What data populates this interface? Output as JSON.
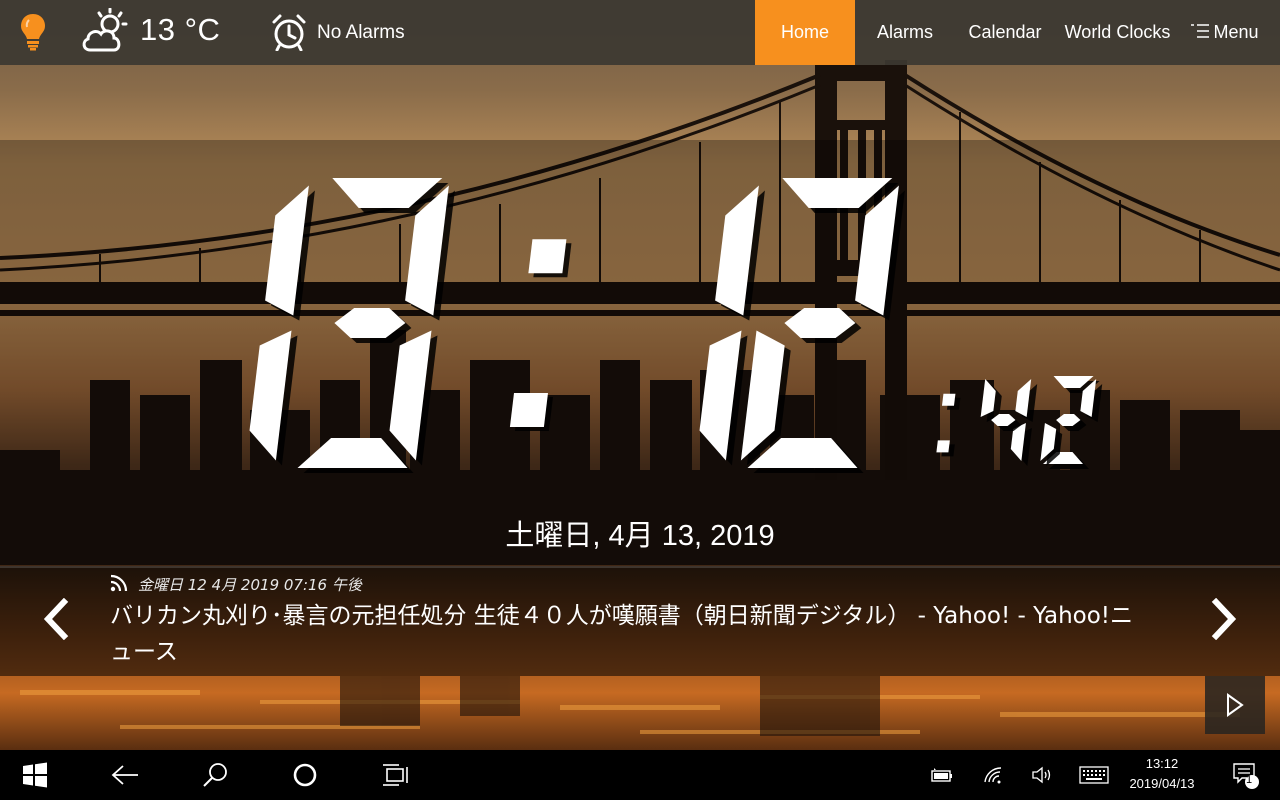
{
  "header": {
    "weather_icon": "partly-cloudy-icon",
    "temperature": "13 °C",
    "alarm_icon": "alarm-clock-icon",
    "alarm_status": "No Alarms",
    "accent_color": "#f7901e",
    "nav": [
      {
        "label": "Home",
        "active": true
      },
      {
        "label": "Alarms",
        "active": false
      },
      {
        "label": "Calendar",
        "active": false
      },
      {
        "label": "World Clocks",
        "active": false
      }
    ],
    "menu_label": "Menu"
  },
  "clock": {
    "hours": "13",
    "minutes": "12",
    "seconds": "42",
    "date": "土曜日, 4月 13, 2019"
  },
  "news": {
    "published": "金曜日 12 4月 2019 07:16 午後",
    "headline": "バリカン丸刈り･暴言の元担任処分 生徒４０人が嘆願書（朝日新聞デジタル） - Yahoo! - Yahoo!ニュース"
  },
  "taskbar": {
    "time": "13:12",
    "date": "2019/04/13",
    "notification_count": "1",
    "icons": [
      "windows-start-icon",
      "back-arrow-icon",
      "search-icon",
      "cortana-icon",
      "task-view-icon",
      "battery-icon",
      "wifi-icon",
      "volume-icon",
      "keyboard-icon",
      "notification-icon"
    ]
  }
}
